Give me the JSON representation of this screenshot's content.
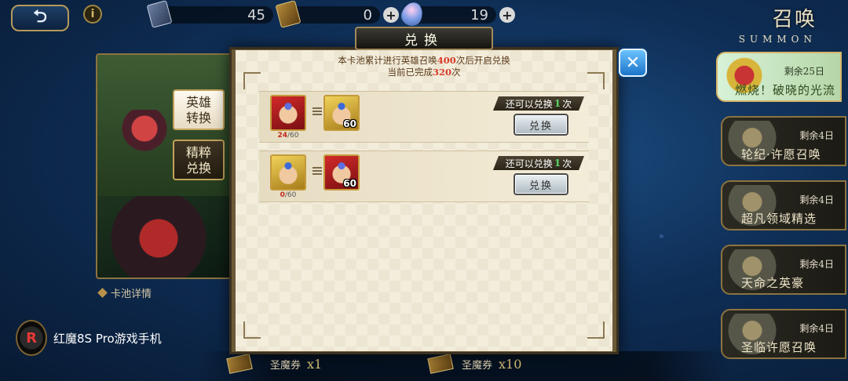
{
  "top_bar": {
    "back_icon": "back-arrow-icon",
    "info_icon": "info-icon",
    "resources": [
      {
        "name": "summon-ticket",
        "value": "45",
        "has_plus": false
      },
      {
        "name": "gold-ticket",
        "value": "0",
        "has_plus": true
      },
      {
        "name": "crystal",
        "value": "19",
        "has_plus": true
      }
    ],
    "plus_label": "+",
    "title": "召唤",
    "subtitle": "SUMMON"
  },
  "left_panel": {
    "tabs": [
      {
        "label_line1": "英雄",
        "label_line2": "转换",
        "active": true
      },
      {
        "label_line1": "精粹",
        "label_line2": "兑换",
        "active": false
      }
    ],
    "pool_detail": "卡池详情"
  },
  "dialog": {
    "title": "兑换",
    "close_icon": "close-icon",
    "notice": {
      "line1_prefix": "本卡池累计进行英雄召唤",
      "line1_count": "400",
      "line1_suffix": "次后开启兑换",
      "line2_prefix": "当前已完成",
      "line2_count": "320",
      "line2_suffix": "次"
    },
    "rows": [
      {
        "from_portrait": "red-hero",
        "progress_current": "24",
        "progress_total": "/60",
        "to_portrait": "gold-hero",
        "to_count": "60",
        "remaining_prefix": "还可以兑换",
        "remaining_count": "1",
        "remaining_suffix": "次",
        "button_label": "兑换"
      },
      {
        "from_portrait": "gold-hero",
        "progress_current": "0",
        "progress_total": "/60",
        "to_portrait": "red-hero",
        "to_count": "60",
        "remaining_prefix": "还可以兑换",
        "remaining_count": "1",
        "remaining_suffix": "次",
        "button_label": "兑换"
      }
    ]
  },
  "right_banners": [
    {
      "remain": "剩余25日",
      "name": "燃烧！破晓的光流",
      "active": true
    },
    {
      "remain": "剩余4日",
      "name": "轮纪·许愿召唤",
      "active": false
    },
    {
      "remain": "剩余4日",
      "name": "超凡领域精选",
      "active": false
    },
    {
      "remain": "剩余4日",
      "name": "天命之英豪",
      "active": false
    },
    {
      "remain": "剩余4日",
      "name": "圣临许愿召唤",
      "active": false
    }
  ],
  "bottom": {
    "tickets": [
      {
        "label": "圣魔券",
        "multiplier": "x1"
      },
      {
        "label": "圣魔券",
        "multiplier": "x10"
      }
    ]
  },
  "watermark": {
    "logo_text": "R",
    "text": "红魔8S Pro游戏手机"
  }
}
